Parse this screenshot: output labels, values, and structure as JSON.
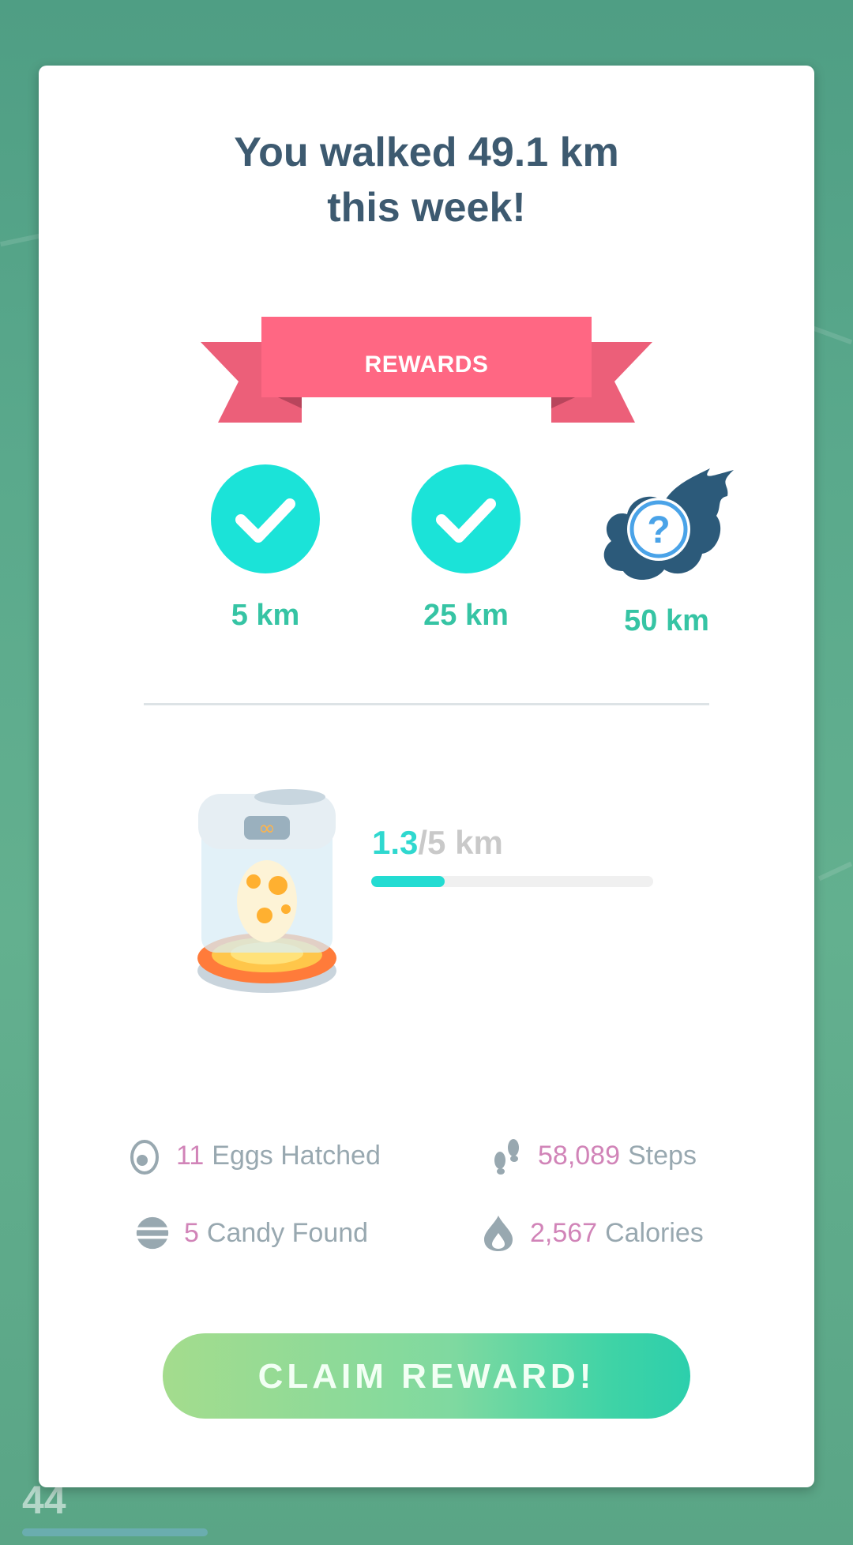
{
  "title": {
    "line1": "You walked 49.1 km",
    "line2": "this week!"
  },
  "banner": {
    "label": "REWARDS",
    "color": "#ff6783"
  },
  "milestones": [
    {
      "label": "5 km",
      "status": "completed",
      "icon": "check-icon"
    },
    {
      "label": "25 km",
      "status": "completed",
      "icon": "check-icon"
    },
    {
      "label": "50 km",
      "status": "mystery",
      "icon": "mystery-encounter-icon"
    }
  ],
  "incubator": {
    "current": "1.3",
    "target": "/5 km",
    "progress_fraction": 0.26,
    "icon": "egg-incubator-icon"
  },
  "stats": {
    "eggs": {
      "value": "11",
      "label": "Eggs Hatched",
      "icon": "egg-icon"
    },
    "steps": {
      "value": "58,089",
      "label": "Steps",
      "icon": "footsteps-icon"
    },
    "candy": {
      "value": "5",
      "label": "Candy Found",
      "icon": "candy-icon"
    },
    "calories": {
      "value": "2,567",
      "label": "Calories",
      "icon": "flame-icon"
    }
  },
  "claim_button": {
    "label": "CLAIM REWARD!"
  },
  "background": {
    "player_level": "44"
  },
  "colors": {
    "accent_teal": "#1be3d8",
    "milestone_text": "#36c4a4",
    "stat_number": "#d184b8",
    "title_text": "#3d5a70"
  }
}
